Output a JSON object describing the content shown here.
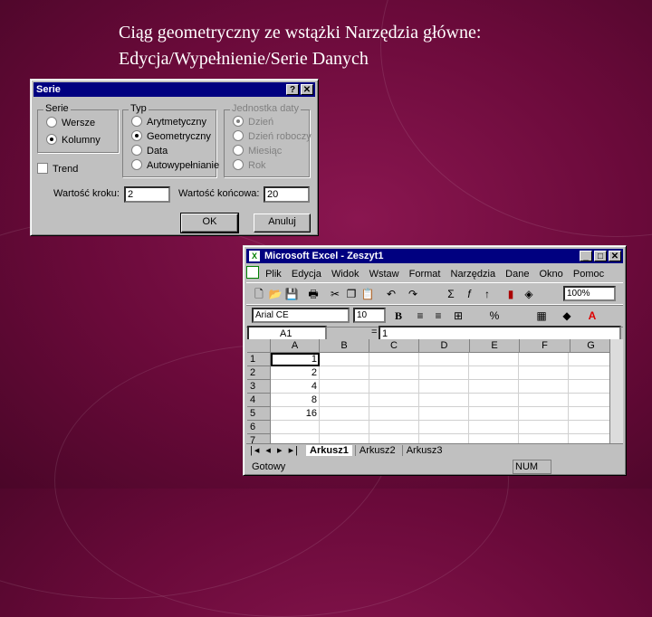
{
  "slide": {
    "title_line1": "Ciąg geometryczny ze wstążki Narzędzia główne:",
    "title_line2": "Edycja/Wypełnienie/Serie Danych"
  },
  "dialog": {
    "title": "Serie",
    "help_btn": "?",
    "close_btn": "✕",
    "series_group": {
      "label": "Serie",
      "options": [
        "Wersze",
        "Kolumny"
      ],
      "selected": "Kolumny"
    },
    "type_group": {
      "label": "Typ",
      "options": [
        "Arytmetyczny",
        "Geometryczny",
        "Data",
        "Autowypełnianie"
      ],
      "selected": "Geometryczny"
    },
    "date_group": {
      "label": "Jednostka daty",
      "options": [
        "Dzień",
        "Dzień roboczy",
        "Miesiąc",
        "Rok"
      ],
      "selected": "Dzień"
    },
    "trend_label": "Trend",
    "step_label": "Wartość kroku:",
    "step_value": "2",
    "stop_label": "Wartość końcowa:",
    "stop_value": "20",
    "ok_label": "OK",
    "cancel_label": "Anuluj"
  },
  "excel": {
    "title": "Microsoft Excel - Zeszyt1",
    "menu": [
      "Plik",
      "Edycja",
      "Widok",
      "Wstaw",
      "Format",
      "Narzędzia",
      "Dane",
      "Okno",
      "Pomoc"
    ],
    "zoom": "100%",
    "font_name": "Arial CE",
    "font_size": "10",
    "name_box": "A1",
    "formula_eq": "=",
    "formula_value": "1",
    "columns": [
      "A",
      "B",
      "C",
      "D",
      "E",
      "F",
      "G"
    ],
    "rows": [
      "1",
      "2",
      "3",
      "4",
      "5",
      "6",
      "7"
    ],
    "colA_values": [
      "1",
      "2",
      "4",
      "8",
      "16",
      "",
      ""
    ],
    "sheet_tabs": [
      "Arkusz1",
      "Arkusz2",
      "Arkusz3"
    ],
    "status_text": "Gotowy",
    "status_num": "NUM"
  }
}
